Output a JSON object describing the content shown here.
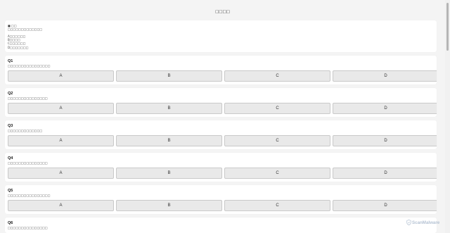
{
  "page": {
    "title": "□□□□"
  },
  "intro": {
    "heading": "■ □□",
    "description": "□□□□□□□□□□□□□",
    "blank": "",
    "options": [
      "A□□□□□□",
      "B□□□□",
      "C□□□□□□",
      "D□□□□□□□"
    ]
  },
  "questions": [
    {
      "label": "Q1",
      "text": "□□□□□□□□□□□□□□□□",
      "options": [
        "A",
        "B",
        "C",
        "D"
      ]
    },
    {
      "label": "Q2",
      "text": "□□□□□□□□□□□□□□□",
      "options": [
        "A",
        "B",
        "C",
        "D"
      ]
    },
    {
      "label": "Q3",
      "text": "□□□□□□□□□□□□□",
      "options": [
        "A",
        "B",
        "C",
        "D"
      ]
    },
    {
      "label": "Q4",
      "text": "□□□□□□□□□□□□□□□",
      "options": [
        "A",
        "B",
        "C",
        "D"
      ]
    },
    {
      "label": "Q5",
      "text": "□□□□□□□□□□□□□□□□",
      "options": [
        "A",
        "B",
        "C",
        "D"
      ]
    },
    {
      "label": "Q6",
      "text": "□□□□□□□□□□□□□□□"
    }
  ],
  "watermark": {
    "text": "ScanMalware",
    "icon": "shield-icon"
  },
  "colors": {
    "background": "#f4f4f4",
    "card": "#ffffff",
    "button": "#e9e9e9",
    "button_border": "#c9c9c9",
    "text": "#333333",
    "watermark": "#a8b8cc"
  }
}
